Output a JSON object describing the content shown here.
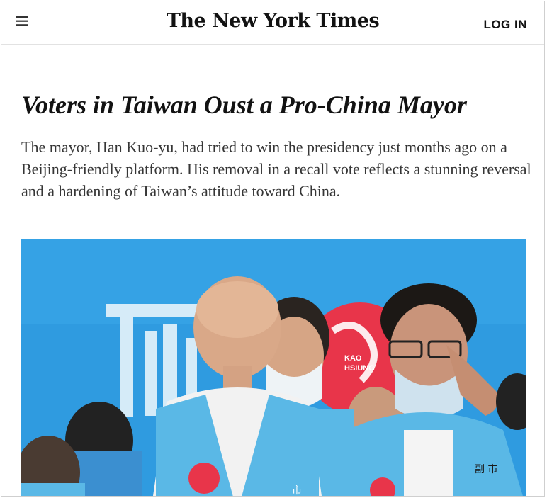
{
  "header": {
    "menu_icon": "hamburger-menu-icon",
    "logo_text": "The New York Times",
    "login_label": "LOG IN"
  },
  "article": {
    "headline": "Voters in Taiwan Oust a Pro-China Mayor",
    "summary": "The mayor, Han Kuo-yu, had tried to win the presidency just months ago on a Beijing-friendly platform. His removal in a recall vote reflects a stunning reversal and a hardening of Taiwan’s attitude toward China."
  },
  "photo": {
    "sign_text": "KAO\nHSIUNG",
    "sign_line1": "KAO",
    "sign_line2": "HSIUNG",
    "vest_text_left": "市",
    "vest_text_right": "副\n市"
  },
  "colors": {
    "text_primary": "#121212",
    "text_summary": "#363636",
    "photo_sky": "#2f9be0",
    "vest_blue": "#5ab8e6",
    "badge_red": "#e8354a"
  }
}
